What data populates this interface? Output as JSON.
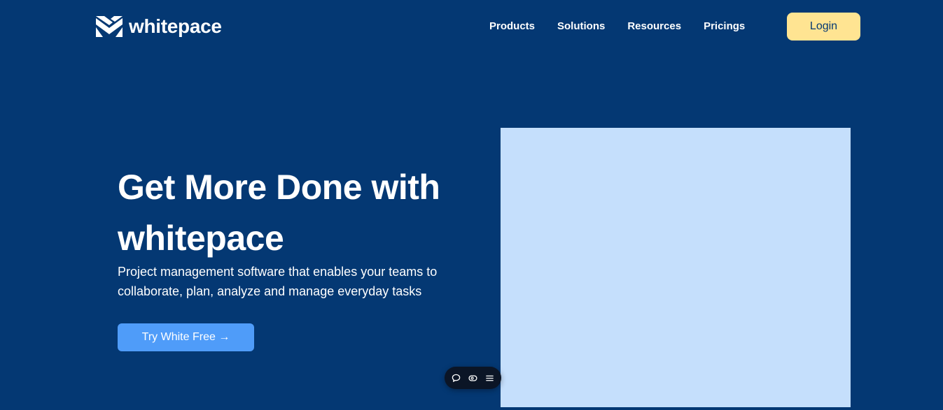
{
  "brand": {
    "name": "whitepace",
    "logo_icon": "whitepace-logo-icon"
  },
  "nav": {
    "items": [
      {
        "label": "Products"
      },
      {
        "label": "Solutions"
      },
      {
        "label": "Resources"
      },
      {
        "label": "Pricings"
      }
    ],
    "login_label": "Login"
  },
  "hero": {
    "title": "Get More Done with whitepace",
    "subtitle": "Project management software that enables your teams to collaborate, plan, analyze and manage everyday tasks",
    "cta_label": "Try White Free →"
  },
  "toolbar": {
    "icons": [
      "comment-icon",
      "eye-icon",
      "menu-icon"
    ]
  },
  "colors": {
    "background": "#043873",
    "login_button": "#ffe492",
    "cta_button": "#4f9cf9",
    "image_placeholder": "#c5dffc",
    "toolbar": "#0b1526"
  }
}
